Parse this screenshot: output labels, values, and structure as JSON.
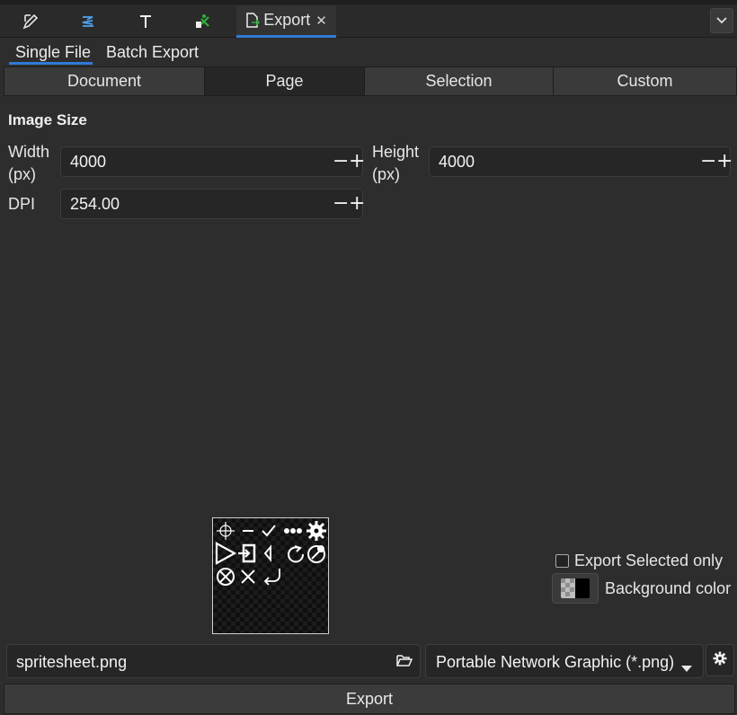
{
  "dock": {
    "tabs": [
      {
        "icon": "pencil-edit-icon"
      },
      {
        "icon": "layers-icon"
      },
      {
        "icon": "text-tool-icon"
      },
      {
        "icon": "scissors-icon"
      },
      {
        "icon": "export-document-icon",
        "label": "Export",
        "close": "✕"
      }
    ],
    "menu_icon": "chevron-down-icon"
  },
  "subtabs": {
    "single_file": "Single File",
    "batch_export": "Batch Export"
  },
  "scope": {
    "options": [
      "Document",
      "Page",
      "Selection",
      "Custom"
    ],
    "selected": "Page"
  },
  "image_size": {
    "title": "Image Size",
    "width_label": "Width",
    "width_unit": "(px)",
    "width_value": "4000",
    "height_label": "Height",
    "height_unit": "(px)",
    "height_value": "4000",
    "dpi_label": "DPI",
    "dpi_value": "254.00",
    "minus": "−",
    "plus": "+"
  },
  "options": {
    "export_selected_only": "Export Selected only",
    "export_selected_checked": false,
    "background_color": "Background color"
  },
  "file": {
    "filename": "spritesheet.png",
    "format": "Portable Network Graphic (*.png)"
  },
  "export_button": "Export",
  "colors": {
    "accent": "#2f7bd6",
    "background": "#2d2d2d"
  }
}
